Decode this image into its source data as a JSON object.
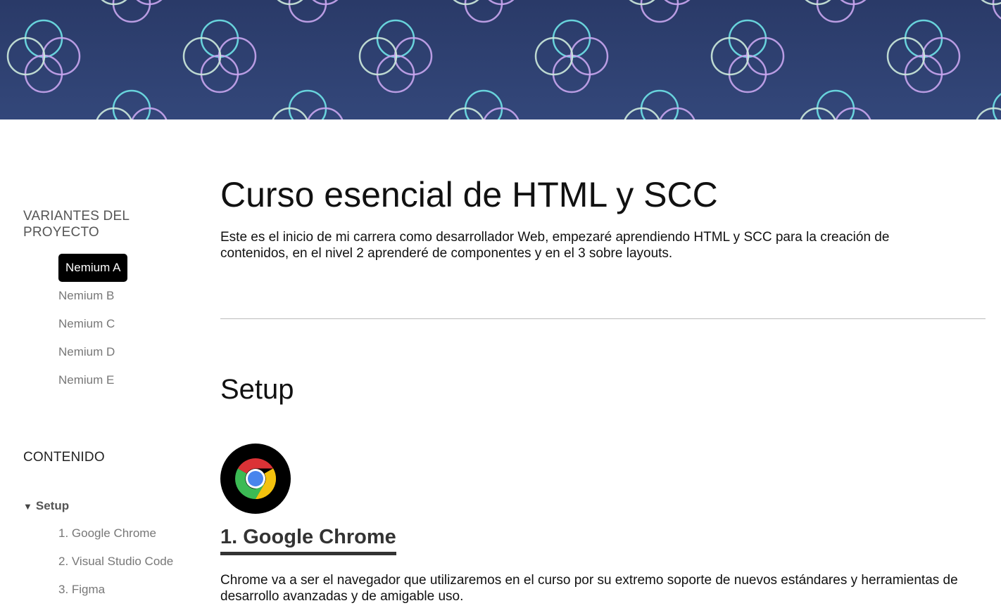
{
  "banner": {
    "pattern": "quatrefoil-circles",
    "colors": [
      "#2a3a68",
      "#6fe3e8",
      "#c9a6ef",
      "#cdeadb"
    ]
  },
  "sidebar": {
    "variants_heading": "VARIANTES DEL PROYECTO",
    "variants": [
      {
        "label": "Nemium A",
        "active": true
      },
      {
        "label": "Nemium B",
        "active": false
      },
      {
        "label": "Nemium C",
        "active": false
      },
      {
        "label": "Nemium D",
        "active": false
      },
      {
        "label": "Nemium E",
        "active": false
      }
    ],
    "contents_heading": "CONTENIDO",
    "toc": {
      "group_label": "Setup",
      "group_icon": "caret-down-icon",
      "items": [
        "1. Google Chrome",
        "2. Visual Studio Code",
        "3. Figma"
      ]
    }
  },
  "main": {
    "title": "Curso esencial de HTML y SCC",
    "intro": "Este es el inicio de mi carrera como desarrollador Web, empezaré aprendiendo HTML y SCC para la creación de contenidos, en el nivel 2 aprenderé de componentes y en el 3 sobre layouts.",
    "section_title": "Setup",
    "tool": {
      "icon": "chrome-logo-icon",
      "title": "1. Google Chrome",
      "description": "Chrome va a ser el navegador que utilizaremos en el curso por su extremo soporte de nuevos estándares y herramientas de desarrollo avanzadas y de amigable uso."
    }
  }
}
